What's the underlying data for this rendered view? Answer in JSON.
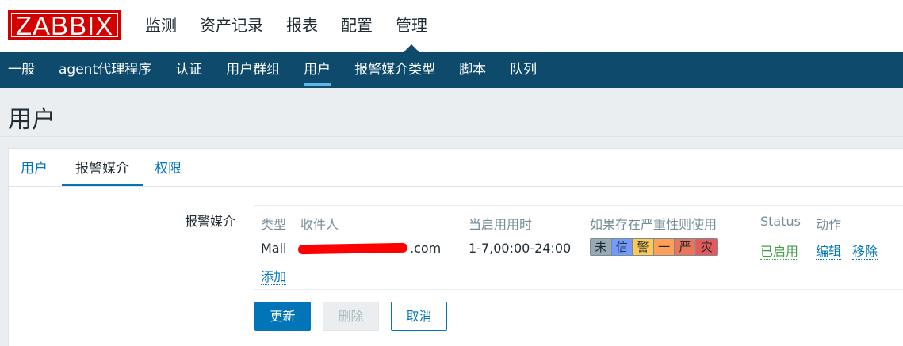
{
  "logo": {
    "text": "ZABBIX"
  },
  "top_nav": [
    {
      "label": "监测"
    },
    {
      "label": "资产记录"
    },
    {
      "label": "报表"
    },
    {
      "label": "配置"
    },
    {
      "label": "管理",
      "active": true
    }
  ],
  "sub_nav": [
    {
      "label": "一般"
    },
    {
      "label": "agent代理程序"
    },
    {
      "label": "认证"
    },
    {
      "label": "用户群组"
    },
    {
      "label": "用户",
      "active": true
    },
    {
      "label": "报警媒介类型"
    },
    {
      "label": "脚本"
    },
    {
      "label": "队列"
    }
  ],
  "page_title": "用户",
  "tabs": [
    {
      "label": "用户"
    },
    {
      "label": "报警媒介",
      "active": true
    },
    {
      "label": "权限"
    }
  ],
  "form": {
    "label": "报警媒介",
    "columns": {
      "type": "类型",
      "recipient": "收件人",
      "when_active": "当启用用时",
      "severity": "如果存在严重性则使用",
      "status": "Status",
      "action": "动作"
    },
    "row": {
      "type": "Mail",
      "recipient_visible_suffix": ".com",
      "when_active": "1-7,00:00-24:00",
      "severity_levels": [
        {
          "label": "未",
          "color": "#97aab3"
        },
        {
          "label": "信",
          "color": "#7499ff"
        },
        {
          "label": "警",
          "color": "#ffc859"
        },
        {
          "label": "一",
          "color": "#ffa059"
        },
        {
          "label": "严",
          "color": "#e97659"
        },
        {
          "label": "灾",
          "color": "#e45959"
        }
      ],
      "status": "已启用",
      "edit": "编辑",
      "remove": "移除"
    },
    "add": "添加"
  },
  "buttons": {
    "update": "更新",
    "delete": "删除",
    "cancel": "取消"
  }
}
